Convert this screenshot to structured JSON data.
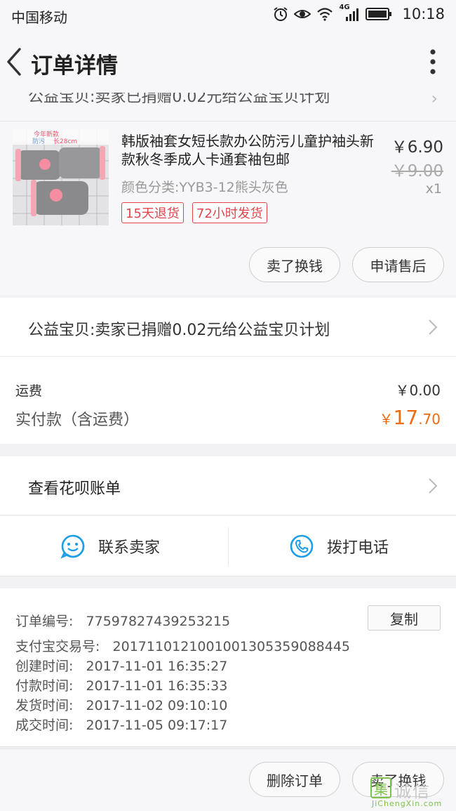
{
  "status_bar": {
    "carrier": "中国移动",
    "network": "4G",
    "time": "10:18",
    "icons": [
      "alarm-icon",
      "eye-icon",
      "wifi-icon",
      "signal-icon",
      "battery-icon"
    ]
  },
  "nav": {
    "title": "订单详情",
    "back_icon": "chevron-left-icon",
    "more_icon": "more-vertical-icon"
  },
  "product": {
    "charity_partial": "公益宝贝:卖家已捐赠0.02元给公益宝贝计划",
    "title": "韩版袖套女短长款办公防污儿童护袖头新款秋冬季成人卡通套袖包邮",
    "sku": "颜色分类:YYB3-12熊头灰色",
    "price_now": "￥6.90",
    "price_original": "￥9.00",
    "quantity": "x1",
    "badges": [
      "15天退货",
      "72小时发货"
    ],
    "image_text": [
      "今年新款",
      "防污",
      "长28cm"
    ],
    "buttons": {
      "sell": "卖了换钱",
      "after_sale": "申请售后"
    }
  },
  "charity": {
    "text": "公益宝贝:卖家已捐赠0.02元给公益宝贝计划"
  },
  "costs": {
    "shipping_label": "运费",
    "shipping_value": "￥0.00",
    "paid_label": "实付款（含运费）",
    "paid_currency": "￥",
    "paid_integer": "17",
    "paid_decimal": ".70"
  },
  "huabei": {
    "label": "查看花呗账单"
  },
  "contact": {
    "seller_label": "联系卖家",
    "phone_label": "拨打电话"
  },
  "order_info": {
    "copy_label": "复制",
    "lines": [
      {
        "label": "订单编号:",
        "value": "77597827439253215"
      },
      {
        "label": "支付宝交易号:",
        "value": "2017110121001001305359088445"
      },
      {
        "label": "创建时间:",
        "value": "2017-11-01 16:35:27"
      },
      {
        "label": "付款时间:",
        "value": "2017-11-01 16:35:33"
      },
      {
        "label": "发货时间:",
        "value": "2017-11-02 09:10:10"
      },
      {
        "label": "成交时间:",
        "value": "2017-11-05 09:17:17"
      }
    ]
  },
  "bottom": {
    "delete_label": "删除订单",
    "sell_label": "卖了换钱"
  },
  "watermark": {
    "mark": "集",
    "name": "诚信",
    "url": "JiChengXin.com"
  },
  "colors": {
    "accent_orange": "#f06a10",
    "badge_red": "#e0464b",
    "icon_blue": "#1e9ee8"
  }
}
